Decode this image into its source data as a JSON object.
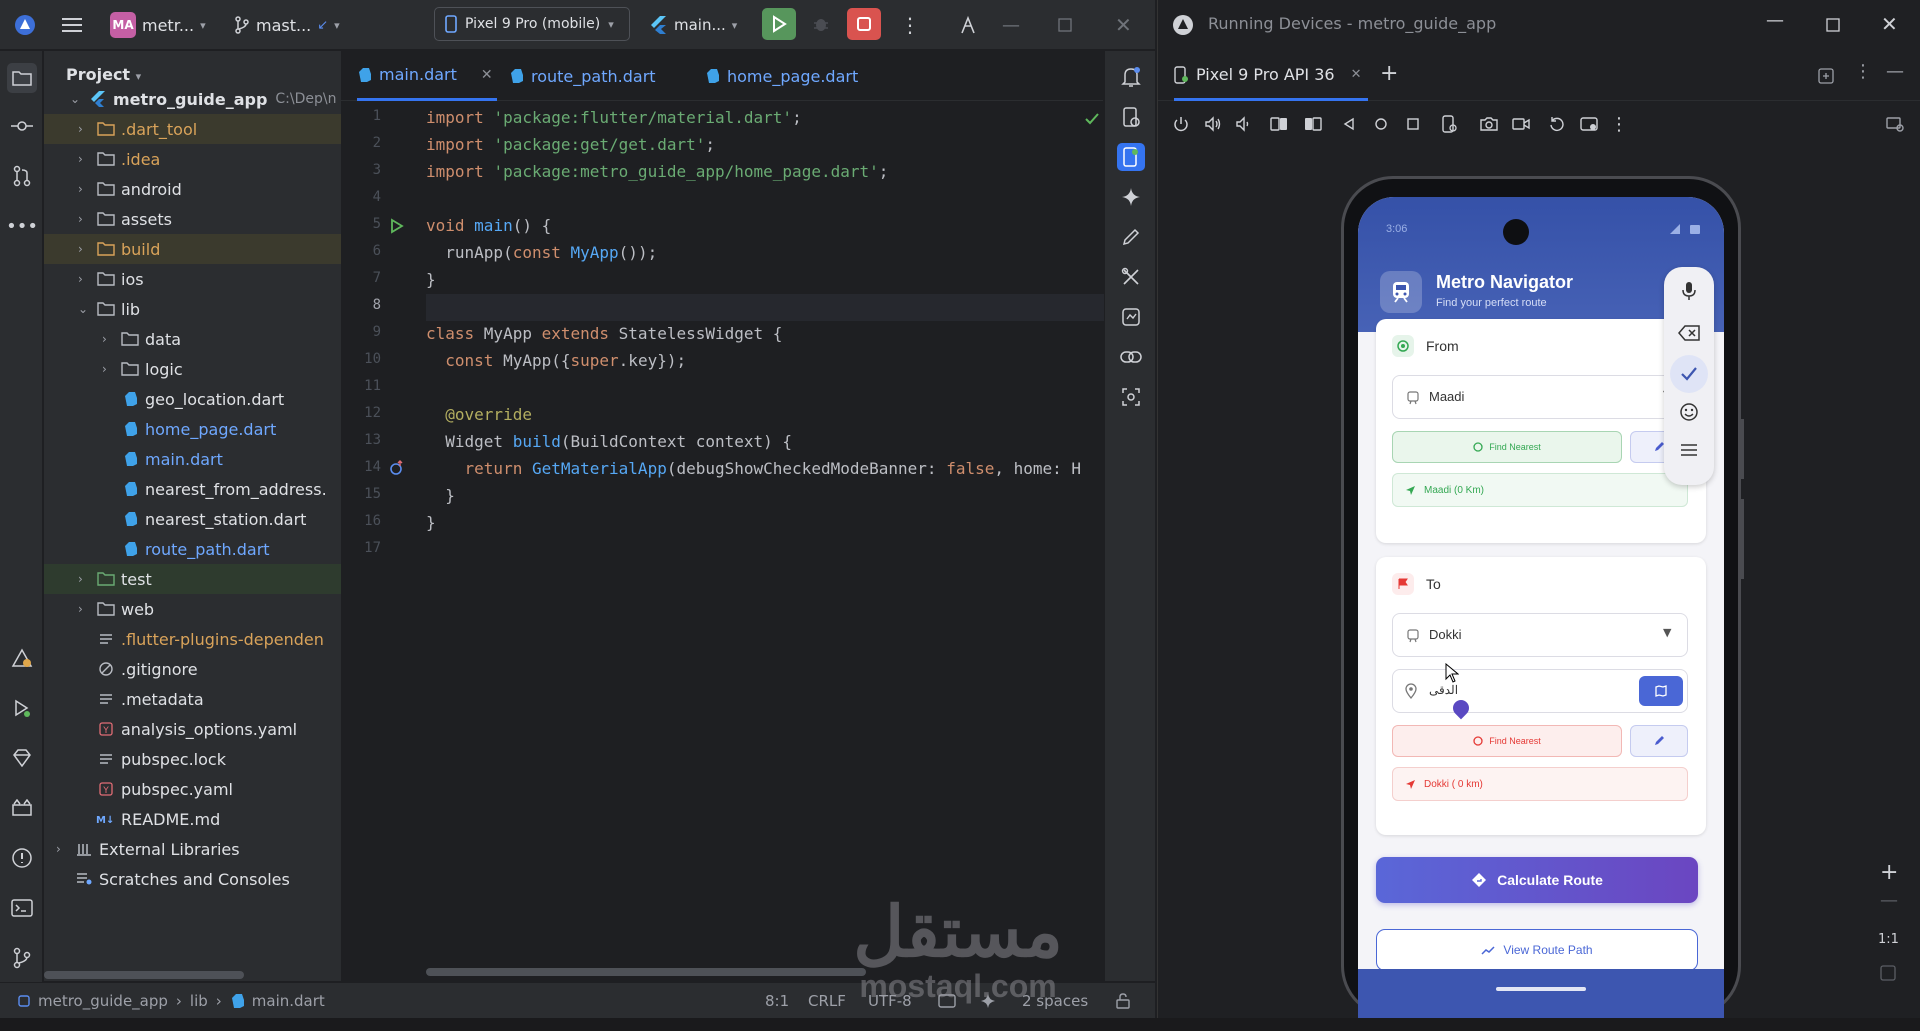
{
  "titlebar": {
    "project_badge": "MA",
    "project_name": "metr...",
    "branch": "mast...",
    "device": "Pixel 9 Pro (mobile)",
    "run_config": "main..."
  },
  "project_panel": {
    "header": "Project",
    "root": {
      "name": "metro_guide_app",
      "path": "C:\\Dep\\n"
    },
    "items": [
      {
        "label": ".dart_tool"
      },
      {
        "label": ".idea"
      },
      {
        "label": "android"
      },
      {
        "label": "assets"
      },
      {
        "label": "build"
      },
      {
        "label": "ios"
      },
      {
        "label": "lib"
      },
      {
        "label": "data"
      },
      {
        "label": "logic"
      },
      {
        "label": "geo_location.dart"
      },
      {
        "label": "home_page.dart"
      },
      {
        "label": "main.dart"
      },
      {
        "label": "nearest_from_address."
      },
      {
        "label": "nearest_station.dart"
      },
      {
        "label": "route_path.dart"
      },
      {
        "label": "test"
      },
      {
        "label": "web"
      },
      {
        "label": ".flutter-plugins-dependen"
      },
      {
        "label": ".gitignore"
      },
      {
        "label": ".metadata"
      },
      {
        "label": "analysis_options.yaml"
      },
      {
        "label": "pubspec.lock"
      },
      {
        "label": "pubspec.yaml"
      },
      {
        "label": "README.md"
      },
      {
        "label": "External Libraries"
      },
      {
        "label": "Scratches and Consoles"
      }
    ]
  },
  "editor": {
    "tabs": [
      "main.dart",
      "route_path.dart",
      "home_page.dart"
    ],
    "line_numbers": [
      "1",
      "2",
      "3",
      "4",
      "5",
      "6",
      "7",
      "8",
      "9",
      "10",
      "11",
      "12",
      "13",
      "14",
      "15",
      "16",
      "17"
    ]
  },
  "code": {
    "l1a": "import ",
    "l1b": "'package:flutter/material.dart'",
    "l1c": ";",
    "l2a": "import ",
    "l2b": "'package:get/get.dart'",
    "l2c": ";",
    "l3a": "import ",
    "l3b": "'package:metro_guide_app/home_page.dart'",
    "l3c": ";",
    "l5a": "void ",
    "l5b": "main",
    "l5c": "() {",
    "l6a": "  runApp(",
    "l6b": "const ",
    "l6c": "MyApp",
    "l6d": "());",
    "l7": "}",
    "l9a": "class ",
    "l9b": "MyApp ",
    "l9c": "extends ",
    "l9d": "StatelessWidget {",
    "l10a": "  const ",
    "l10b": "MyApp({",
    "l10c": "super",
    "l10d": ".key});",
    "l12": "  @override",
    "l13a": "  Widget ",
    "l13b": "build",
    "l13c": "(BuildContext context) {",
    "l14a": "    return ",
    "l14b": "GetMaterialApp",
    "l14c": "(debugShowCheckedModeBanner: ",
    "l14d": "false",
    "l14e": ", home: H",
    "l15": "  }",
    "l16": "}"
  },
  "statusbar": {
    "crumb_root": "metro_guide_app",
    "crumb_dir": "lib",
    "crumb_file": "main.dart",
    "position": "8:1",
    "line_sep": "CRLF",
    "encoding": "UTF-8",
    "indent": "2 spaces"
  },
  "devices": {
    "window_title": "Running Devices - metro_guide_app",
    "tab": "Pixel 9 Pro API 36",
    "zoom": "1:1"
  },
  "app": {
    "status_time": "3:06",
    "title": "Metro Navigator",
    "subtitle": "Find your perfect route",
    "from_label": "From",
    "from_value": "Maadi",
    "from_find_btn": "Find Nearest",
    "from_result": "Maadi (0 Km)",
    "to_label": "To",
    "to_value": "Dokki",
    "to_input": "الدقى",
    "to_find_btn": "Find Nearest",
    "to_result": "Dokki ( 0 km)",
    "calc_btn": "Calculate Route",
    "view_btn": "View Route Path"
  },
  "watermark": {
    "arabic": "مستقل",
    "latin": "mostaql.com"
  },
  "colors": {
    "accent": "#3574f0",
    "run_green": "#5fb85c",
    "stop_red": "#e55b5b",
    "app_primary": "#3d56b0",
    "calc_gradient_start": "#5a67d8",
    "calc_gradient_end": "#6b46c1"
  }
}
